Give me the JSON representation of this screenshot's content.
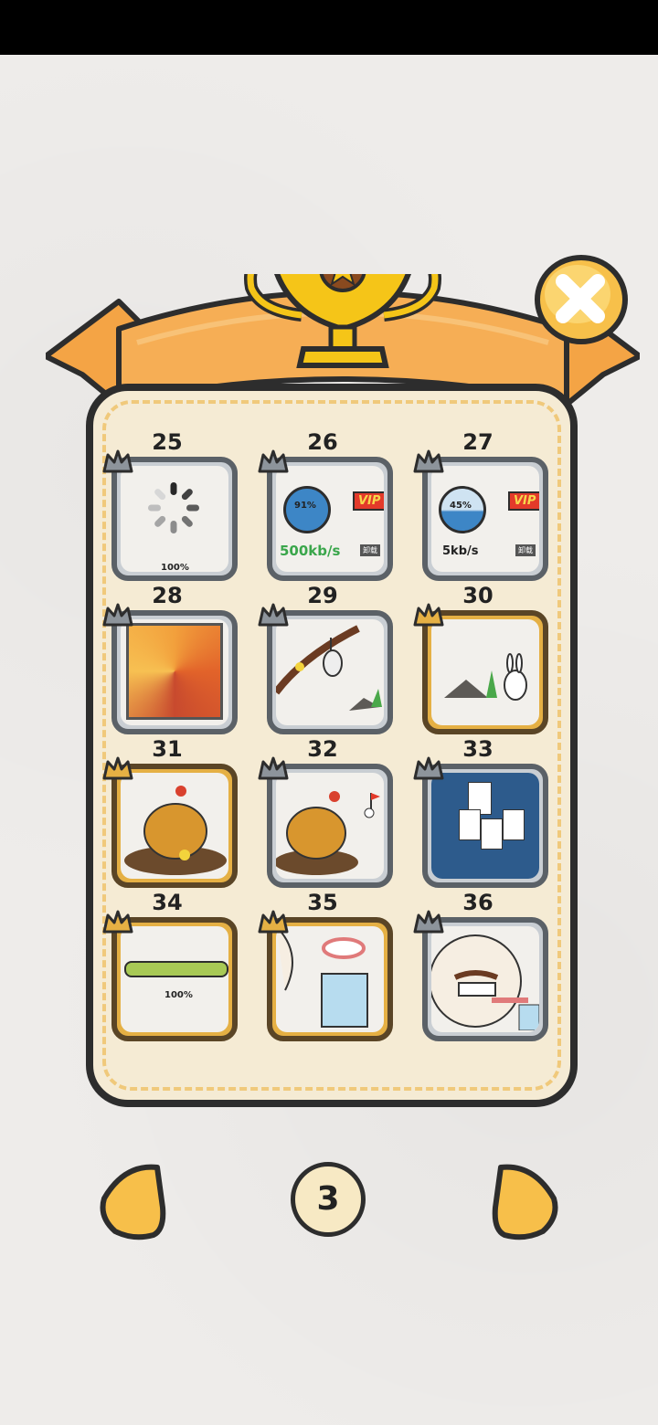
{
  "dialog": {
    "close_label": "close"
  },
  "levels": [
    {
      "number": "25",
      "locked": true,
      "progress_label": "100%"
    },
    {
      "number": "26",
      "locked": true,
      "progress_label": "91%",
      "speed_label": "500kb/s",
      "vip_label": "VIP",
      "unload_label": "卸载"
    },
    {
      "number": "27",
      "locked": true,
      "progress_label": "45%",
      "speed_label": "5kb/s",
      "vip_label": "VIP",
      "unload_label": "卸载"
    },
    {
      "number": "28",
      "locked": true
    },
    {
      "number": "29",
      "locked": true
    },
    {
      "number": "30",
      "locked": false
    },
    {
      "number": "31",
      "locked": false
    },
    {
      "number": "32",
      "locked": true
    },
    {
      "number": "33",
      "locked": true
    },
    {
      "number": "34",
      "locked": false,
      "progress_label": "100%"
    },
    {
      "number": "35",
      "locked": false
    },
    {
      "number": "36",
      "locked": true
    }
  ],
  "pagination": {
    "current_page": "3"
  },
  "colors": {
    "ribbon": "#f4a445",
    "panel": "#f5ebd4",
    "trophy": "#f5c518",
    "nav_button": "#f7bf4a",
    "speed_green": "#3aa64b"
  }
}
